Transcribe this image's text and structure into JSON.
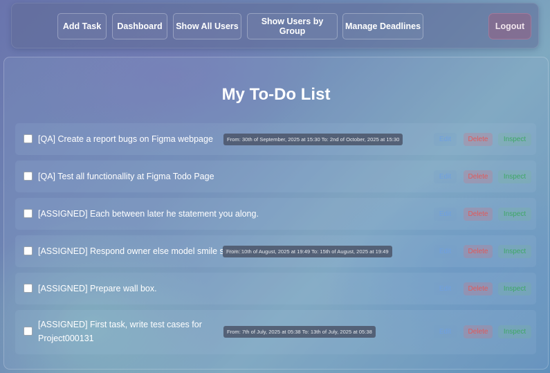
{
  "nav": {
    "add_task": "Add Task",
    "dashboard": "Dashboard",
    "show_all_users": "Show All Users",
    "show_users_by_group": "Show Users by Group",
    "manage_deadlines": "Manage Deadlines",
    "logout": "Logout"
  },
  "page_title": "My To-Do List",
  "actions": {
    "edit": "Edit",
    "delete": "Delete",
    "inspect": "Inspect"
  },
  "tasks": [
    {
      "text": "[QA] Create a report bugs on Figma webpage",
      "deadline": "From: 30th of September, 2025 at 15:30 To: 2nd of October, 2025 at 15:30",
      "checked": false
    },
    {
      "text": "[QA] Test all functionallity at Figma Todo Page",
      "deadline": "",
      "checked": false
    },
    {
      "text": "[ASSIGNED] Each between later he statement you along.",
      "deadline": "",
      "checked": false
    },
    {
      "text": "[ASSIGNED] Respond owner else model smile scene.",
      "deadline": "From: 10th of August, 2025 at 19:49 To: 15th of August, 2025 at 19:49",
      "checked": false
    },
    {
      "text": "[ASSIGNED] Prepare wall box.",
      "deadline": "",
      "checked": false
    },
    {
      "text": "[ASSIGNED] First task, write test cases for Project000131",
      "deadline": "From: 7th of July, 2025 at 05:38 To: 13th of July, 2025 at 05:38",
      "checked": false
    }
  ]
}
